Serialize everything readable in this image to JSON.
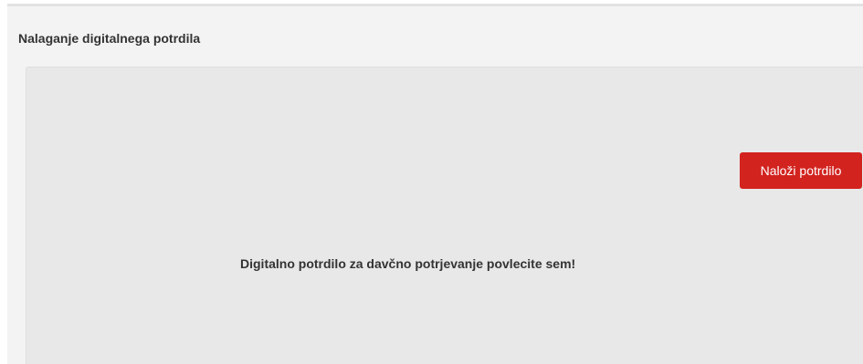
{
  "panel": {
    "title": "Nalaganje digitalnega potrdila"
  },
  "dropzone": {
    "instruction": "Digitalno potrdilo za davčno potrjevanje povlecite sem!",
    "upload_button_label": "Naloži potrdilo"
  },
  "colors": {
    "accent": "#d2231f",
    "panel_background": "#f3f3f3",
    "dropzone_background": "#e8e8e8",
    "text": "#333333"
  }
}
